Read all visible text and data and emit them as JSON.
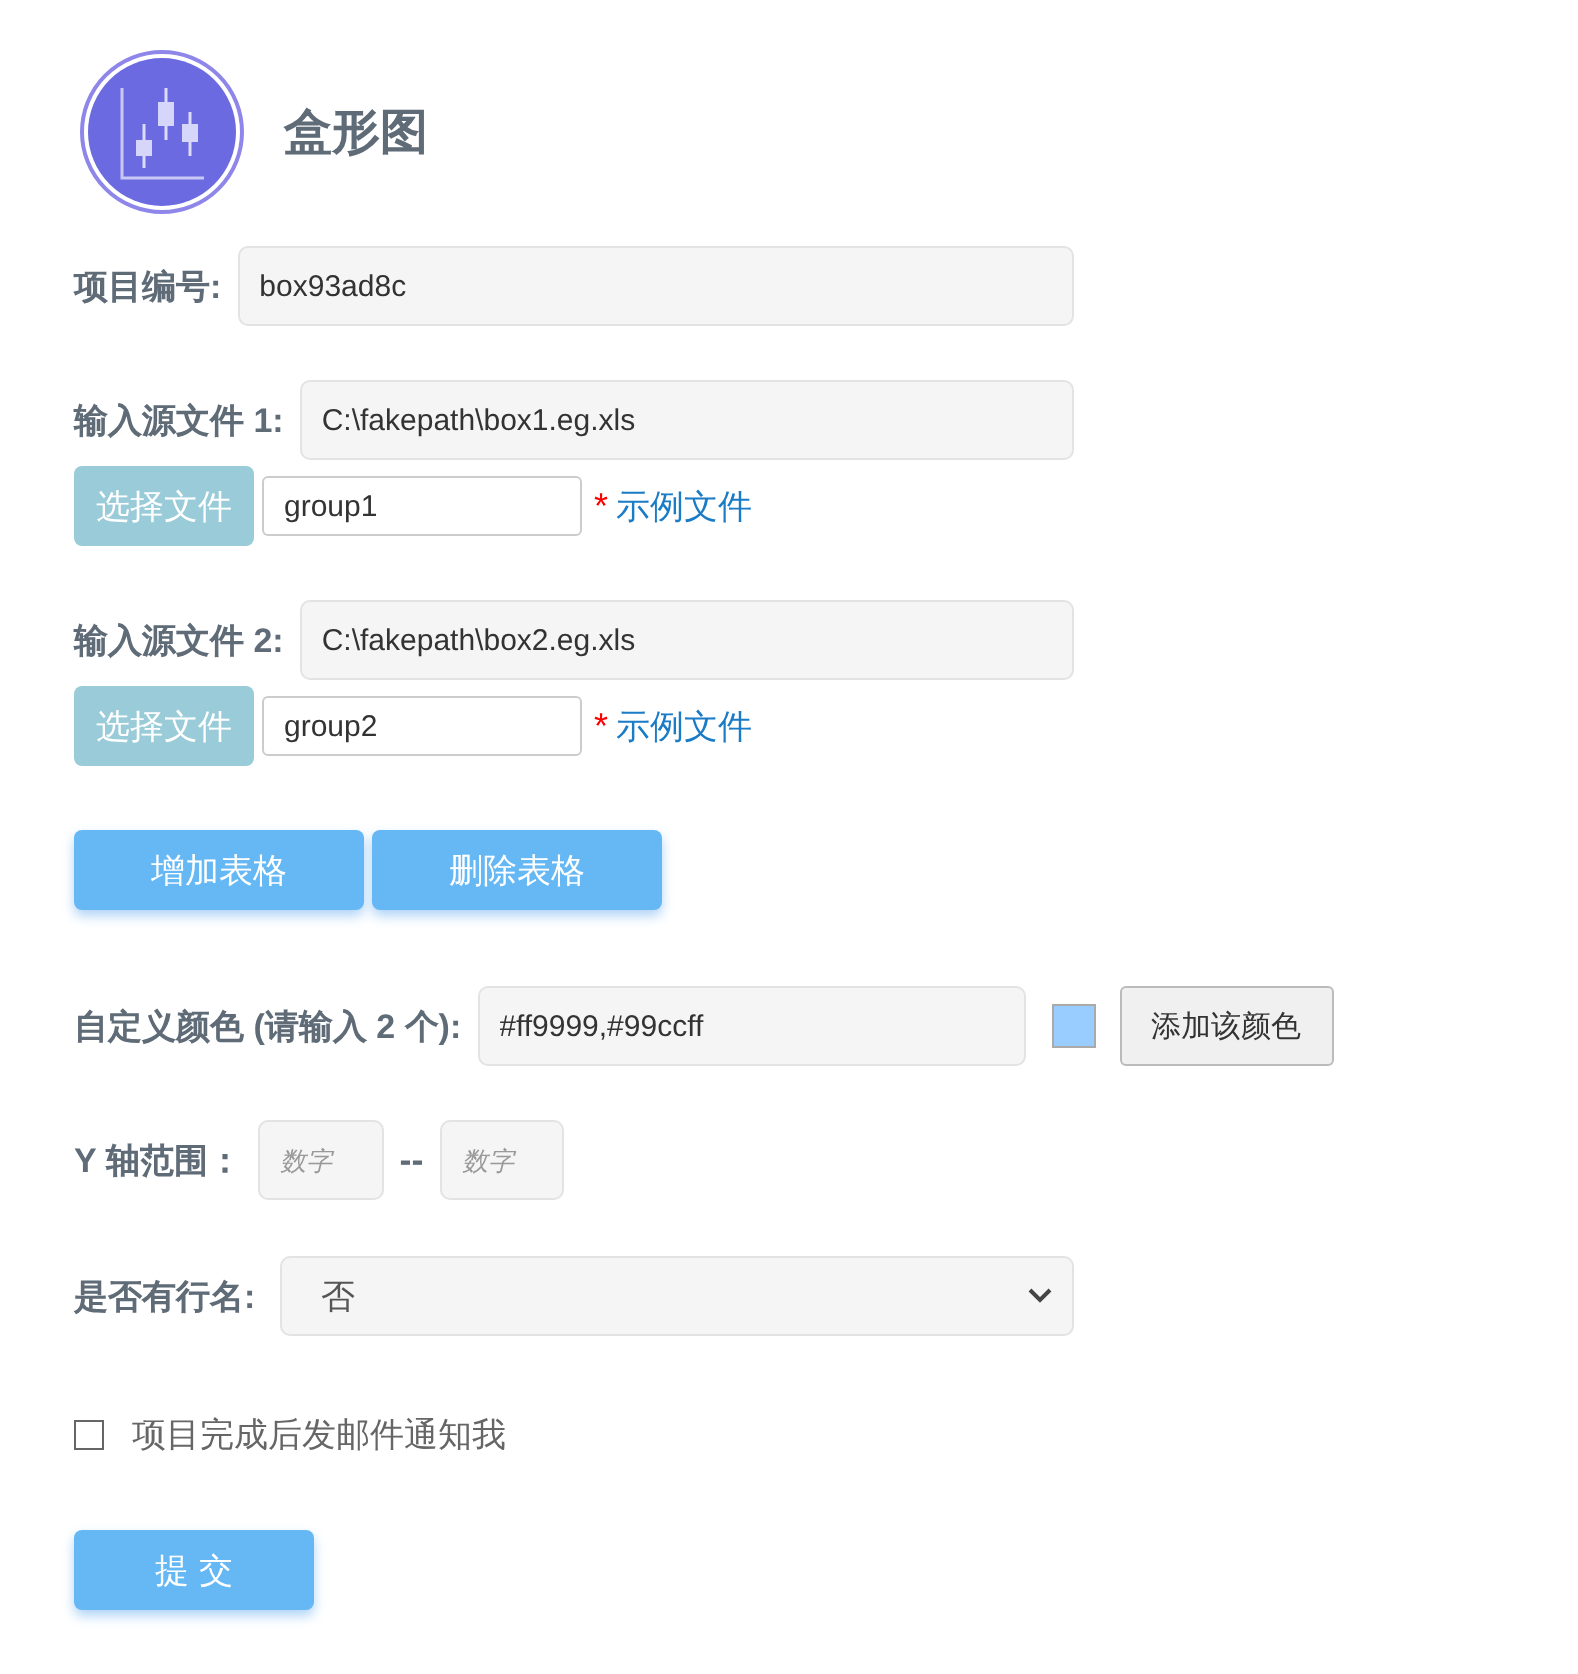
{
  "header": {
    "title": "盒形图"
  },
  "project": {
    "label": "项目编号:",
    "value": "box93ad8c"
  },
  "sources": [
    {
      "label": "输入源文件 1:",
      "path": "C:\\fakepath\\box1.eg.xls",
      "choose": "选择文件",
      "group": "group1",
      "required": "*",
      "example": "示例文件"
    },
    {
      "label": "输入源文件 2:",
      "path": "C:\\fakepath\\box2.eg.xls",
      "choose": "选择文件",
      "group": "group2",
      "required": "*",
      "example": "示例文件"
    }
  ],
  "table_buttons": [
    "增加表格",
    "删除表格"
  ],
  "colors": {
    "label": "自定义颜色 (请输入 2 个):",
    "value": "#ff9999,#99ccff",
    "swatch": {
      "color": "#99ccff"
    },
    "button": "添加该颜色"
  },
  "y_range": {
    "label": "Y 轴范围：",
    "min_placeholder": "数字",
    "separator": "--",
    "max_placeholder": "数字"
  },
  "row_names": {
    "label": "是否有行名:",
    "value": "否"
  },
  "notify": {
    "label": "项目完成后发邮件通知我",
    "checked": false
  },
  "submit": "提 交"
}
